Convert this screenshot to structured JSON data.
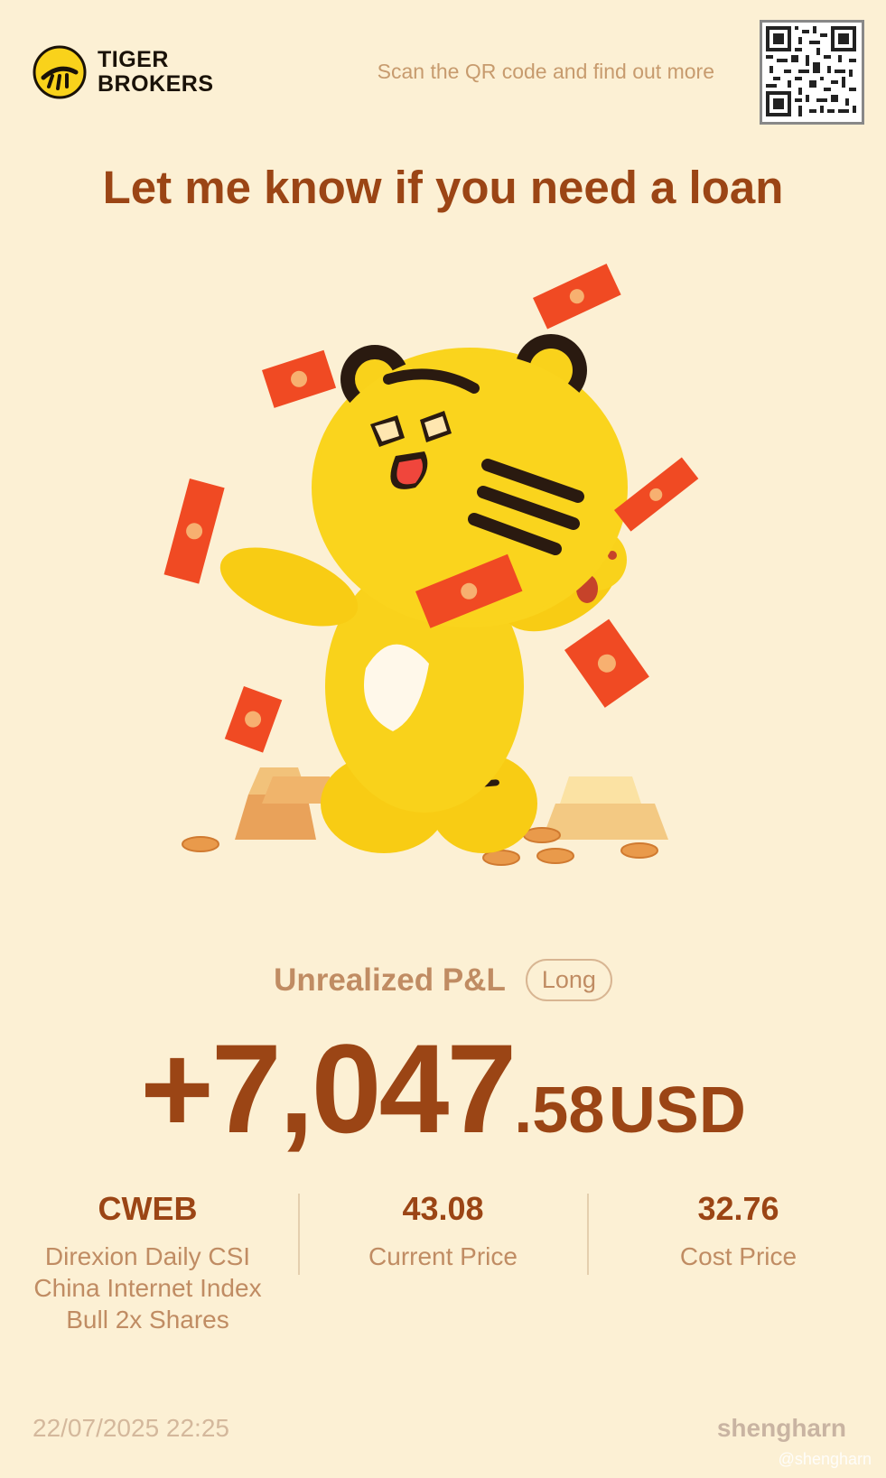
{
  "header": {
    "brand_line1": "TIGER",
    "brand_line2": "BROKERS",
    "qr_caption": "Scan the QR code and find out more"
  },
  "headline": "Let me know if you need a loan",
  "pnl": {
    "label": "Unrealized P&L",
    "position_type": "Long",
    "amount_integer": "+7,047",
    "amount_decimal": ".58",
    "currency": "USD"
  },
  "stats": {
    "ticker": "CWEB",
    "ticker_name": "Direxion Daily CSI China Internet Index Bull 2x Shares",
    "current_price": "43.08",
    "current_price_label": "Current Price",
    "cost_price": "32.76",
    "cost_price_label": "Cost Price"
  },
  "footer": {
    "timestamp": "22/07/2025 22:25",
    "watermark": "shengharn",
    "watermark_handle": "@shengharn"
  },
  "colors": {
    "background": "#fcf0d4",
    "primary_text": "#9b4515",
    "secondary_text": "#c08c63",
    "tiger_yellow": "#f9d21b",
    "red_envelope": "#f04a23"
  },
  "icons": [
    "tiger-brokers-logo-icon",
    "qr-code-icon",
    "tiger-mascot-illustration"
  ]
}
